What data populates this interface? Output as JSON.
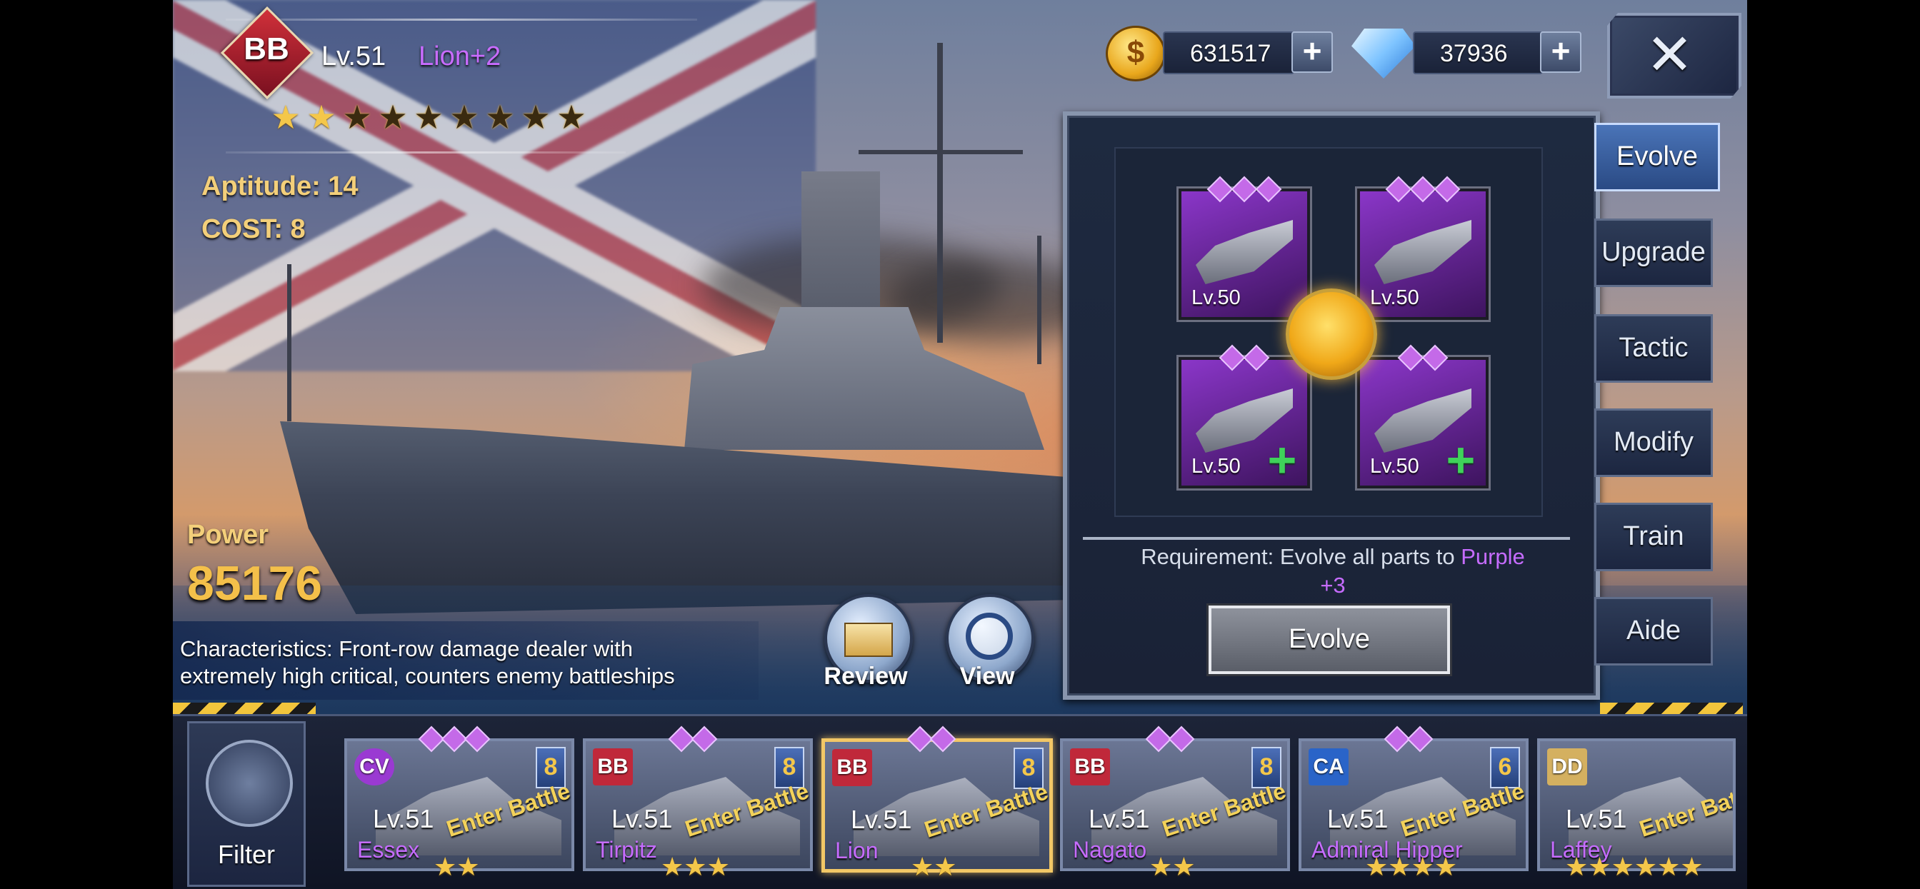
{
  "ship": {
    "class": "BB",
    "level": "Lv.51",
    "name": "Lion+2",
    "stars_filled": 2,
    "stars_total": 9,
    "aptitude": "Aptitude: 14",
    "cost": "COST:  8",
    "power_label": "Power",
    "power_value": "85176",
    "characteristics": "Characteristics: Front-row damage dealer with extremely high critical, counters enemy battleships"
  },
  "actions": {
    "review_label": "Review",
    "view_label": "View"
  },
  "currency": {
    "gold": "631517",
    "diamonds": "37936",
    "coin_symbol": "$"
  },
  "close_symbol": "✕",
  "evolve_panel": {
    "parts": [
      {
        "level": "Lv.50",
        "gems": 3,
        "can_add": false
      },
      {
        "level": "Lv.50",
        "gems": 3,
        "can_add": false
      },
      {
        "level": "Lv.50",
        "gems": 2,
        "can_add": true
      },
      {
        "level": "Lv.50",
        "gems": 2,
        "can_add": true
      }
    ],
    "requirement_prefix": "Requirement: Evolve all parts to ",
    "requirement_highlight": "Purple",
    "requirement_suffix": "+3",
    "button_label": "Evolve"
  },
  "tabs": [
    {
      "label": "Evolve",
      "active": true
    },
    {
      "label": "Upgrade",
      "active": false
    },
    {
      "label": "Tactic",
      "active": false
    },
    {
      "label": "Modify",
      "active": false
    },
    {
      "label": "Train",
      "active": false
    },
    {
      "label": "Aide",
      "active": false
    }
  ],
  "filter_label": "Filter",
  "fleet": [
    {
      "class": "CV",
      "name": "Essex",
      "level": "Lv.51",
      "cost": "8",
      "enter": "Enter Battle",
      "gems": 3,
      "stars": 2,
      "selected": false,
      "class_color": "#9a3ad2"
    },
    {
      "class": "BB",
      "name": "Tirpitz",
      "level": "Lv.51",
      "cost": "8",
      "enter": "Enter Battle",
      "gems": 2,
      "stars": 3,
      "selected": false,
      "class_color": "#c0283a"
    },
    {
      "class": "BB",
      "name": "Lion",
      "level": "Lv.51",
      "cost": "8",
      "enter": "Enter Battle",
      "gems": 2,
      "stars": 2,
      "selected": true,
      "class_color": "#c0283a"
    },
    {
      "class": "BB",
      "name": "Nagato",
      "level": "Lv.51",
      "cost": "8",
      "enter": "Enter Battle",
      "gems": 2,
      "stars": 2,
      "selected": false,
      "class_color": "#c0283a"
    },
    {
      "class": "CA",
      "name": "Admiral Hipper",
      "level": "Lv.51",
      "cost": "6",
      "enter": "Enter Battle",
      "gems": 2,
      "stars": 4,
      "selected": false,
      "class_color": "#2a64c8"
    },
    {
      "class": "DD",
      "name": "Laffey",
      "level": "Lv.51",
      "cost": "",
      "enter": "Enter Battle",
      "gems": 0,
      "stars": 6,
      "selected": false,
      "class_color": "#d4b060"
    }
  ],
  "colors": {
    "accent_purple": "#c66cff",
    "gold_text": "#f3cf7a",
    "tab_active": "#2a4a84",
    "hazard_yellow": "#f2c53c"
  }
}
